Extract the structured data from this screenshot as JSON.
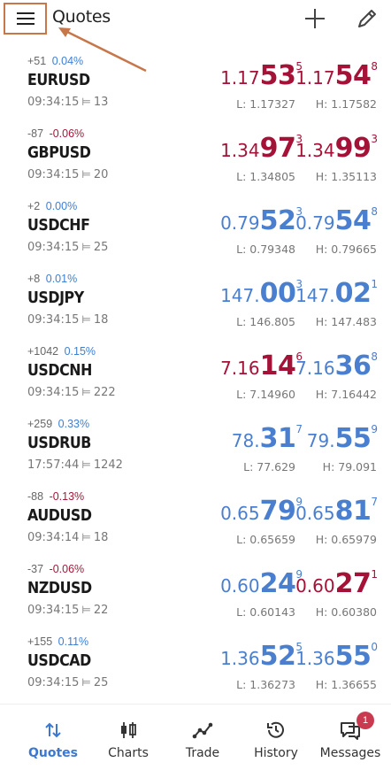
{
  "header": {
    "title": "Quotes"
  },
  "colors": {
    "up": "#4a7fd0",
    "down": "#a51238",
    "active": "#3b78d1",
    "annotation": "#c8774a",
    "badge": "#c93a50"
  },
  "quotes": [
    {
      "change_points": "+51",
      "change_pct": "0.04%",
      "dir": "pos",
      "symbol": "EURUSD",
      "time": "09:34:15",
      "spread": "13",
      "bid": {
        "small": "1.17",
        "big": "53",
        "pip": "5",
        "trend": "down"
      },
      "ask": {
        "small": "1.17",
        "big": "54",
        "pip": "8",
        "trend": "down"
      },
      "low": "L: 1.17327",
      "high": "H: 1.17582"
    },
    {
      "change_points": "-87",
      "change_pct": "-0.06%",
      "dir": "neg",
      "symbol": "GBPUSD",
      "time": "09:34:15",
      "spread": "20",
      "bid": {
        "small": "1.34",
        "big": "97",
        "pip": "3",
        "trend": "down"
      },
      "ask": {
        "small": "1.34",
        "big": "99",
        "pip": "3",
        "trend": "down"
      },
      "low": "L: 1.34805",
      "high": "H: 1.35113"
    },
    {
      "change_points": "+2",
      "change_pct": "0.00%",
      "dir": "pos",
      "symbol": "USDCHF",
      "time": "09:34:15",
      "spread": "25",
      "bid": {
        "small": "0.79",
        "big": "52",
        "pip": "3",
        "trend": "up"
      },
      "ask": {
        "small": "0.79",
        "big": "54",
        "pip": "8",
        "trend": "up"
      },
      "low": "L: 0.79348",
      "high": "H: 0.79665"
    },
    {
      "change_points": "+8",
      "change_pct": "0.01%",
      "dir": "pos",
      "symbol": "USDJPY",
      "time": "09:34:15",
      "spread": "18",
      "bid": {
        "small": "147.",
        "big": "00",
        "pip": "3",
        "trend": "up"
      },
      "ask": {
        "small": "147.",
        "big": "02",
        "pip": "1",
        "trend": "up"
      },
      "low": "L: 146.805",
      "high": "H: 147.483"
    },
    {
      "change_points": "+1042",
      "change_pct": "0.15%",
      "dir": "pos",
      "symbol": "USDCNH",
      "time": "09:34:15",
      "spread": "222",
      "bid": {
        "small": "7.16",
        "big": "14",
        "pip": "6",
        "trend": "down"
      },
      "ask": {
        "small": "7.16",
        "big": "36",
        "pip": "8",
        "trend": "up"
      },
      "low": "L: 7.14960",
      "high": "H: 7.16442"
    },
    {
      "change_points": "+259",
      "change_pct": "0.33%",
      "dir": "pos",
      "symbol": "USDRUB",
      "time": "17:57:44",
      "spread": "1242",
      "bid": {
        "small": "78.",
        "big": "31",
        "pip": "7",
        "trend": "up"
      },
      "ask": {
        "small": "79.",
        "big": "55",
        "pip": "9",
        "trend": "up"
      },
      "low": "L: 77.629",
      "high": "H: 79.091"
    },
    {
      "change_points": "-88",
      "change_pct": "-0.13%",
      "dir": "neg",
      "symbol": "AUDUSD",
      "time": "09:34:14",
      "spread": "18",
      "bid": {
        "small": "0.65",
        "big": "79",
        "pip": "9",
        "trend": "up"
      },
      "ask": {
        "small": "0.65",
        "big": "81",
        "pip": "7",
        "trend": "up"
      },
      "low": "L: 0.65659",
      "high": "H: 0.65979"
    },
    {
      "change_points": "-37",
      "change_pct": "-0.06%",
      "dir": "neg",
      "symbol": "NZDUSD",
      "time": "09:34:15",
      "spread": "22",
      "bid": {
        "small": "0.60",
        "big": "24",
        "pip": "9",
        "trend": "up"
      },
      "ask": {
        "small": "0.60",
        "big": "27",
        "pip": "1",
        "trend": "down"
      },
      "low": "L: 0.60143",
      "high": "H: 0.60380"
    },
    {
      "change_points": "+155",
      "change_pct": "0.11%",
      "dir": "pos",
      "symbol": "USDCAD",
      "time": "09:34:15",
      "spread": "25",
      "bid": {
        "small": "1.36",
        "big": "52",
        "pip": "5",
        "trend": "up"
      },
      "ask": {
        "small": "1.36",
        "big": "55",
        "pip": "0",
        "trend": "up"
      },
      "low": "L: 1.36273",
      "high": "H: 1.36655"
    }
  ],
  "nav": {
    "items": [
      {
        "label": "Quotes",
        "icon": "quotes-icon",
        "active": true
      },
      {
        "label": "Charts",
        "icon": "charts-icon",
        "active": false
      },
      {
        "label": "Trade",
        "icon": "trade-icon",
        "active": false
      },
      {
        "label": "History",
        "icon": "history-icon",
        "active": false
      },
      {
        "label": "Messages",
        "icon": "messages-icon",
        "active": false
      }
    ],
    "messages_badge": "1"
  }
}
